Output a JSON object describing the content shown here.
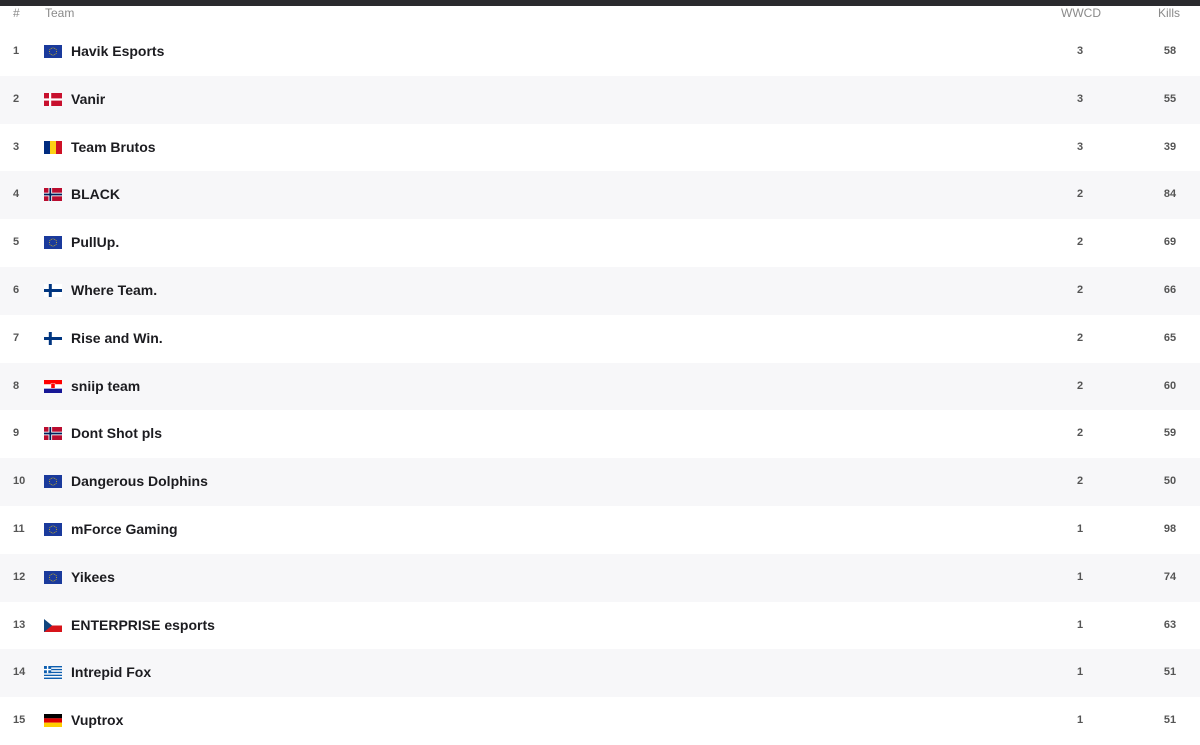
{
  "table": {
    "headers": {
      "rank": "#",
      "team": "Team",
      "wwcd": "WWCD",
      "kills": "Kills"
    },
    "rows": [
      {
        "rank": "1",
        "team": "Havik Esports",
        "flag": "eu",
        "wwcd": "3",
        "kills": "58"
      },
      {
        "rank": "2",
        "team": "Vanir",
        "flag": "denmark",
        "wwcd": "3",
        "kills": "55"
      },
      {
        "rank": "3",
        "team": "Team Brutos",
        "flag": "romania",
        "wwcd": "3",
        "kills": "39"
      },
      {
        "rank": "4",
        "team": "BLACK",
        "flag": "norway",
        "wwcd": "2",
        "kills": "84"
      },
      {
        "rank": "5",
        "team": "PullUp.",
        "flag": "eu",
        "wwcd": "2",
        "kills": "69"
      },
      {
        "rank": "6",
        "team": "Where Team.",
        "flag": "finland",
        "wwcd": "2",
        "kills": "66"
      },
      {
        "rank": "7",
        "team": "Rise and Win.",
        "flag": "finland",
        "wwcd": "2",
        "kills": "65"
      },
      {
        "rank": "8",
        "team": "sniip team",
        "flag": "croatia",
        "wwcd": "2",
        "kills": "60"
      },
      {
        "rank": "9",
        "team": "Dont Shot pls",
        "flag": "norway",
        "wwcd": "2",
        "kills": "59"
      },
      {
        "rank": "10",
        "team": "Dangerous Dolphins",
        "flag": "eu",
        "wwcd": "2",
        "kills": "50"
      },
      {
        "rank": "11",
        "team": "mForce Gaming",
        "flag": "eu",
        "wwcd": "1",
        "kills": "98"
      },
      {
        "rank": "12",
        "team": "Yikees",
        "flag": "eu",
        "wwcd": "1",
        "kills": "74"
      },
      {
        "rank": "13",
        "team": "ENTERPRISE esports",
        "flag": "czechia",
        "wwcd": "1",
        "kills": "63"
      },
      {
        "rank": "14",
        "team": "Intrepid Fox",
        "flag": "greece",
        "wwcd": "1",
        "kills": "51"
      },
      {
        "rank": "15",
        "team": "Vuptrox",
        "flag": "germany",
        "wwcd": "1",
        "kills": "51"
      }
    ]
  }
}
